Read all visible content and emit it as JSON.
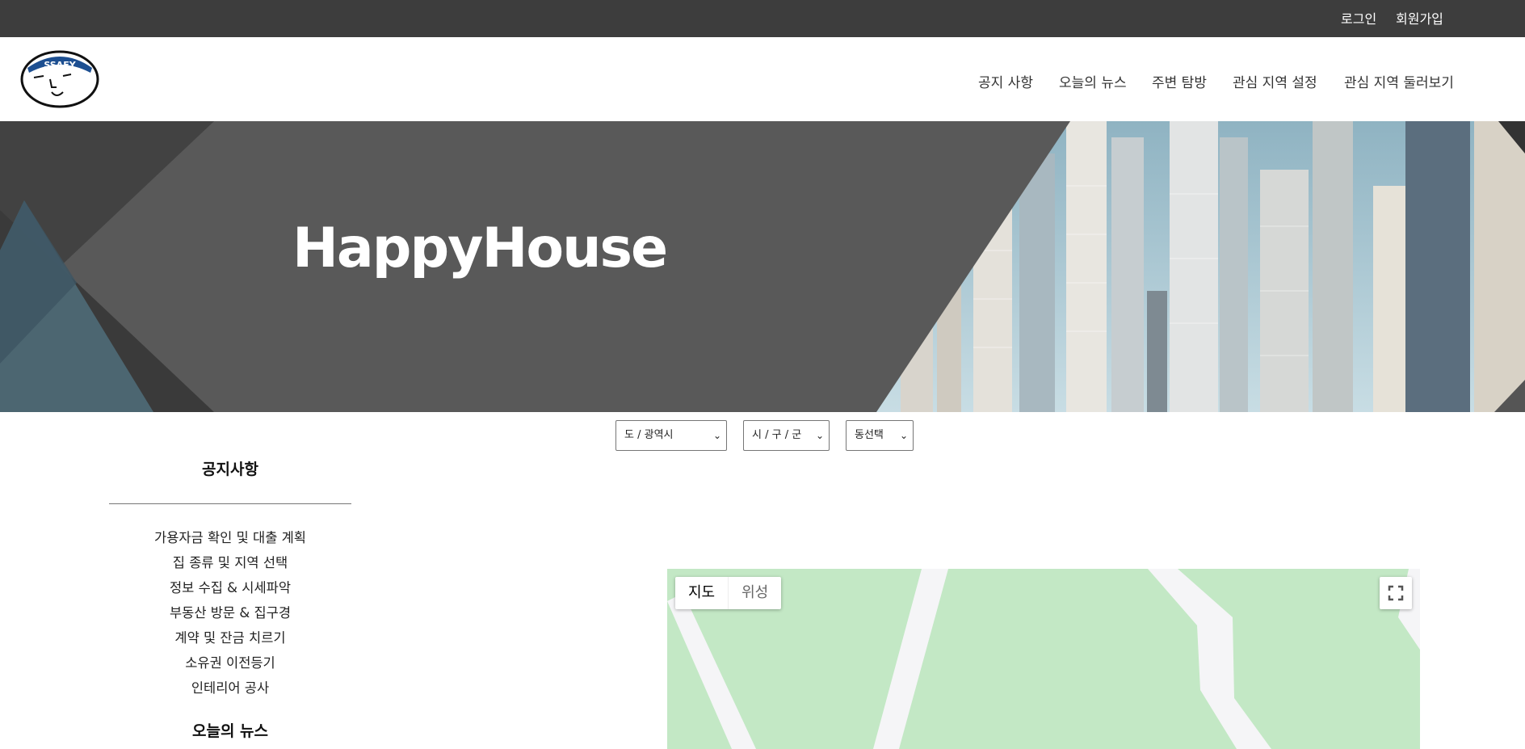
{
  "topbar": {
    "login": "로그인",
    "signup": "회원가입"
  },
  "header": {
    "logo_text": "SSAFY",
    "nav": [
      "공지 사항",
      "오늘의 뉴스",
      "주변 탐방",
      "관심 지역 설정",
      "관심 지역 둘러보기"
    ]
  },
  "hero": {
    "title": "HappyHouse"
  },
  "filters": {
    "sido": "도 / 광역시",
    "gugun": "시 / 구 / 군",
    "dong": "동선택"
  },
  "sidebar": {
    "notice_title": "공지사항",
    "notice_items": [
      "가용자금 확인 및 대출 계획",
      "집 종류 및 지역 선택",
      "정보 수집 & 시세파악",
      "부동산 방문 & 집구경",
      "계약 및 잔금 치르기",
      "소유권 이전등기",
      "인테리어 공사"
    ],
    "news_title": "오늘의 뉴스"
  },
  "map": {
    "type_map": "지도",
    "type_satellite": "위성"
  },
  "colors": {
    "topbar": "#3d3d3d",
    "hero_gray": "#5a5a5a",
    "map_green": "#c3e8c5"
  }
}
